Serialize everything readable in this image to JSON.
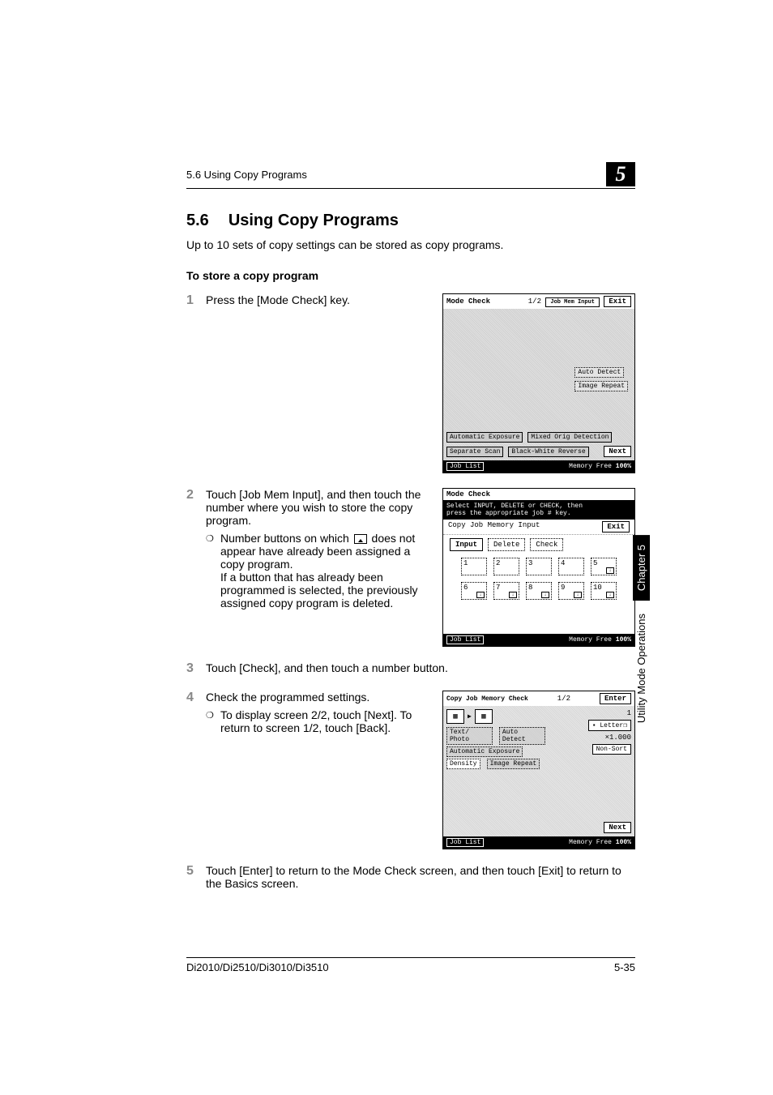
{
  "header": {
    "section_ref": "5.6 Using Copy Programs",
    "chapter_num": "5"
  },
  "title": {
    "num": "5.6",
    "text": "Using Copy Programs"
  },
  "intro": "Up to 10 sets of copy settings can be stored as copy programs.",
  "subheading": "To store a copy program",
  "steps": {
    "s1": {
      "num": "1",
      "text": "Press the [Mode Check] key."
    },
    "s2": {
      "num": "2",
      "text": "Touch [Job Mem Input], and then touch the number where you wish to store the copy program.",
      "bullet_a": "Number buttons on which ",
      "bullet_b": " does not appear have already been assigned a copy program.",
      "bullet_c": "If a button that has already been programmed is selected, the previously assigned copy program is deleted."
    },
    "s3": {
      "num": "3",
      "text": "Touch [Check], and then touch a number button."
    },
    "s4": {
      "num": "4",
      "text": "Check the programmed settings.",
      "bullet": "To display screen 2/2, touch [Next]. To return to screen 1/2, touch [Back]."
    },
    "s5": {
      "num": "5",
      "text": "Touch [Enter] to return to the Mode Check screen, and then touch [Exit] to return to the Basics screen."
    }
  },
  "screenshot1": {
    "title": "Mode Check",
    "page": "1/2",
    "job_mem": "Job Mem Input",
    "exit": "Exit",
    "auto_detect": "Auto Detect",
    "image_repeat": "Image Repeat",
    "auto_exp": "Automatic Exposure",
    "mixed": "Mixed Orig Detection",
    "separate": "Separate Scan",
    "bw_rev": "Black-White Reverse",
    "next": "Next",
    "job_list": "Job List",
    "memory": "Memory Free",
    "mem_pct": "100%"
  },
  "screenshot2": {
    "title": "Mode Check",
    "msg1": "Select INPUT, DELETE or CHECK, then",
    "msg2": "press the appropriate job # key.",
    "subtitle": "Copy Job Memory Input",
    "exit": "Exit",
    "tab_input": "Input",
    "tab_delete": "Delete",
    "tab_check": "Check",
    "nums": [
      "1",
      "2",
      "3",
      "4",
      "5",
      "6",
      "7",
      "8",
      "9",
      "10"
    ],
    "job_list": "Job List",
    "memory": "Memory Free",
    "mem_pct": "100%"
  },
  "screenshot3": {
    "title": "Copy Job Memory Check",
    "page": "1/2",
    "enter": "Enter",
    "val1": "1",
    "letter": "Letter",
    "zoom": "×1.000",
    "nonsort": "Non-Sort",
    "text_photo": "Text/ Photo",
    "auto_exp": "Automatic Exposure",
    "auto_detect": "Auto Detect",
    "density": "Density",
    "image_repeat": "Image Repeat",
    "next": "Next",
    "job_list": "Job List",
    "memory": "Memory Free",
    "mem_pct": "100%"
  },
  "sidebar": {
    "chapter": "Chapter 5",
    "label": "Utility Mode Operations"
  },
  "footer": {
    "model": "Di2010/Di2510/Di3010/Di3510",
    "page": "5-35"
  }
}
